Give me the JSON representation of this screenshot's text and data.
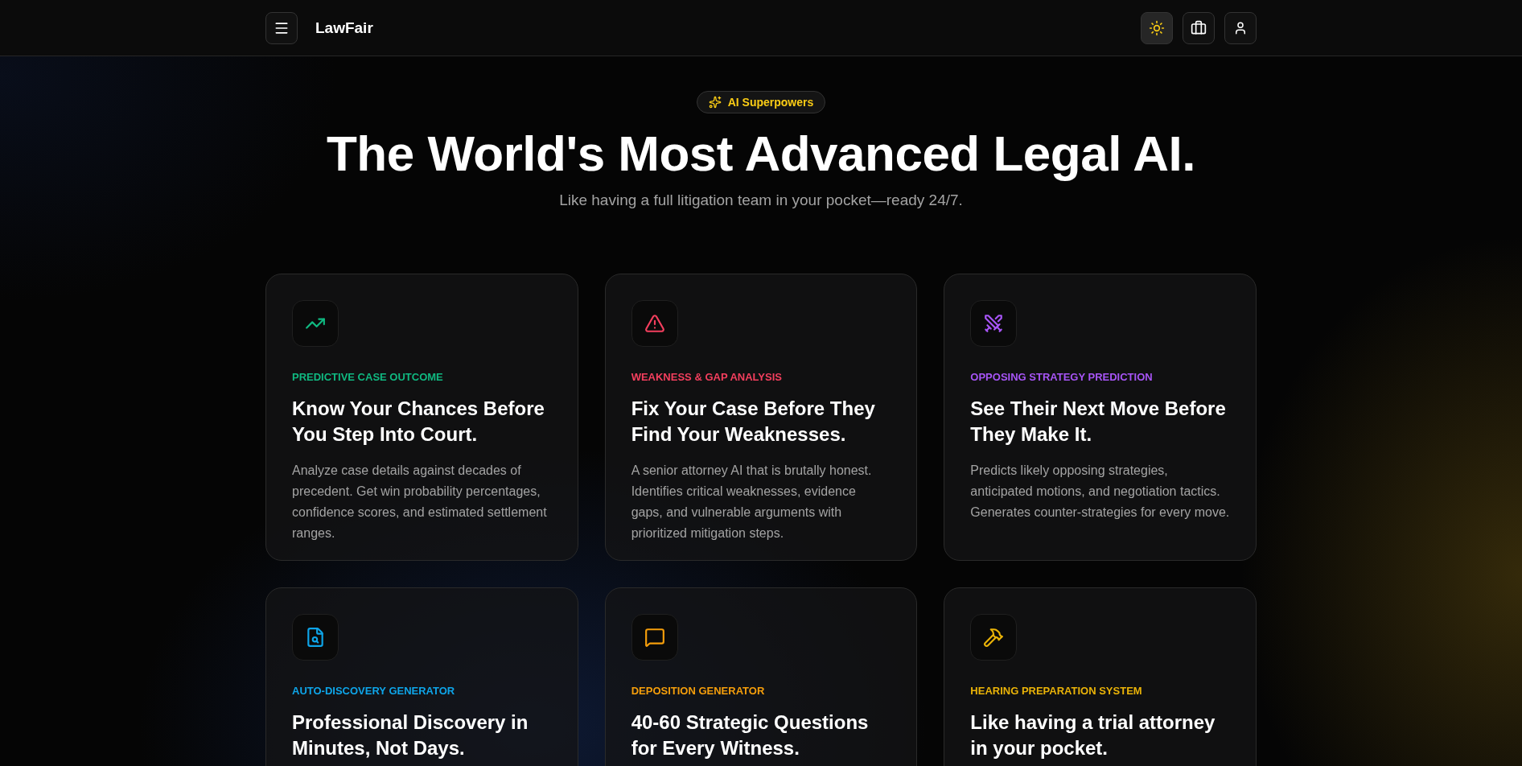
{
  "header": {
    "brand": "LawFair"
  },
  "hero": {
    "badge": "AI Superpowers",
    "title": "The World's Most Advanced Legal AI.",
    "subtitle": "Like having a full litigation team in your pocket—ready 24/7."
  },
  "features": [
    {
      "category": "PREDICTIVE CASE OUTCOME",
      "color": "#10b981",
      "heading": "Know Your Chances Before You Step Into Court.",
      "body": "Analyze case details against decades of precedent. Get win probability percentages, confidence scores, and estimated settlement ranges."
    },
    {
      "category": "WEAKNESS & GAP ANALYSIS",
      "color": "#f43f5e",
      "heading": "Fix Your Case Before They Find Your Weaknesses.",
      "body": "A senior attorney AI that is brutally honest. Identifies critical weaknesses, evidence gaps, and vulnerable arguments with prioritized mitigation steps."
    },
    {
      "category": "OPPOSING STRATEGY PREDICTION",
      "color": "#a855f7",
      "heading": "See Their Next Move Before They Make It.",
      "body": "Predicts likely opposing strategies, anticipated motions, and negotiation tactics. Generates counter-strategies for every move."
    },
    {
      "category": "AUTO-DISCOVERY GENERATOR",
      "color": "#0ea5e9",
      "heading": "Professional Discovery in Minutes, Not Days."
    },
    {
      "category": "DEPOSITION GENERATOR",
      "color": "#f59e0b",
      "heading": "40-60 Strategic Questions for Every Witness."
    },
    {
      "category": "HEARING PREPARATION SYSTEM",
      "color": "#eab308",
      "heading": "Like having a trial attorney in your pocket."
    }
  ]
}
